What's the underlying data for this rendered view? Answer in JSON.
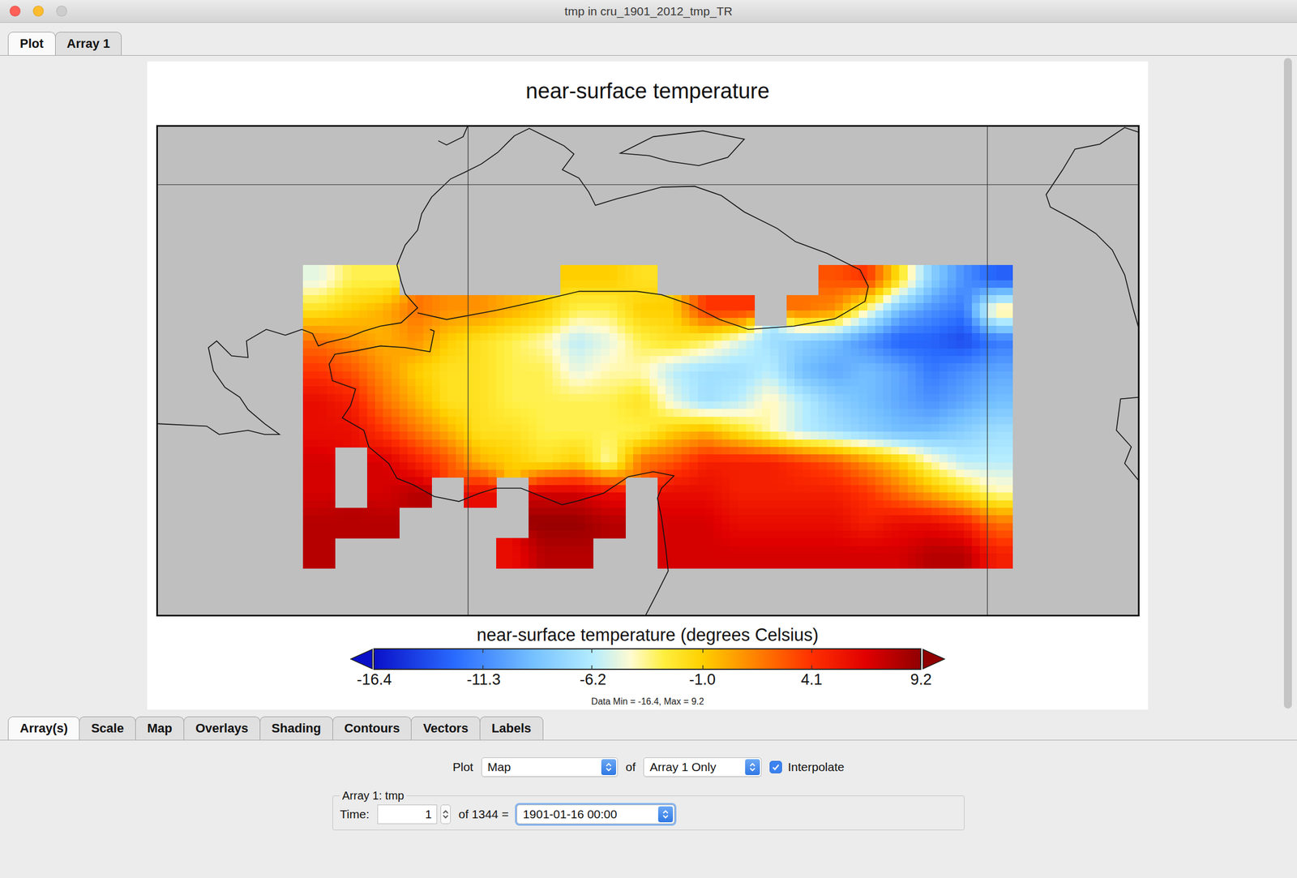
{
  "window": {
    "title": "tmp in cru_1901_2012_tmp_TR"
  },
  "top_tabs": [
    {
      "label": "Plot",
      "selected": true
    },
    {
      "label": "Array 1",
      "selected": false
    }
  ],
  "plot": {
    "title": "near-surface temperature",
    "map": {
      "grid": [
        [
          -5,
          -3,
          -3,
          null,
          null,
          null,
          null,
          null,
          -1,
          -1,
          -2,
          null,
          null,
          null,
          null,
          null,
          3,
          4,
          -2,
          -8,
          -11,
          -13
        ],
        [
          -2,
          -1,
          0,
          2,
          1,
          1,
          0,
          -1,
          -3,
          -3,
          -1,
          -1,
          4,
          4,
          null,
          2,
          1,
          -4,
          -9,
          -11,
          -12,
          -3
        ],
        [
          2,
          1,
          0,
          1,
          -1,
          -2,
          -3,
          -4,
          -6,
          -5,
          -3,
          -2,
          -3,
          -5,
          -7,
          -8,
          -9,
          -11,
          -13,
          -13,
          -14,
          -12
        ],
        [
          4,
          3,
          1,
          -1,
          -2,
          -2,
          -3,
          -3,
          -5,
          -4,
          -4,
          -6,
          -7,
          -7,
          -6,
          -9,
          -10,
          -9,
          -10,
          -12,
          -11,
          -10
        ],
        [
          6,
          5,
          2,
          0,
          -2,
          -2,
          -3,
          -3,
          -3,
          -3,
          -2,
          -5,
          -7,
          -6,
          -4,
          -6,
          -8,
          -9,
          -10,
          -11,
          -10,
          -9
        ],
        [
          6,
          6,
          4,
          2,
          0,
          -2,
          -2,
          -3,
          -3,
          -3,
          -3,
          -1,
          0,
          -2,
          -4,
          -6,
          -7,
          -8,
          -9,
          -9,
          -8,
          -7
        ],
        [
          7,
          null,
          7,
          5,
          3,
          0,
          -1,
          -2,
          -1,
          -4,
          2,
          3,
          5,
          5,
          5,
          4,
          3,
          1,
          -1,
          -4,
          -6,
          -6
        ],
        [
          7,
          null,
          7,
          8,
          null,
          6,
          null,
          7,
          7,
          6,
          null,
          6,
          6,
          5,
          5,
          5,
          5,
          4,
          2,
          0,
          -2,
          -4
        ],
        [
          8,
          8,
          8,
          null,
          null,
          null,
          null,
          9,
          9,
          8,
          null,
          7,
          7,
          6,
          6,
          6,
          6,
          5,
          6,
          6,
          5,
          2
        ],
        [
          8,
          null,
          null,
          null,
          null,
          null,
          6,
          8,
          8,
          null,
          null,
          7,
          7,
          7,
          7,
          7,
          7,
          7,
          7,
          8,
          8,
          5
        ]
      ]
    },
    "colorbar": {
      "label": "near-surface temperature (degrees Celsius)",
      "ticks": [
        "-16.4",
        "-11.3",
        "-6.2",
        "-1.0",
        "4.1",
        "9.2"
      ],
      "min": -16.4,
      "max": 9.2,
      "note": "Data Min = -16.4, Max = 9.2"
    }
  },
  "bottom_tabs": [
    {
      "label": "Array(s)",
      "selected": true
    },
    {
      "label": "Scale",
      "selected": false
    },
    {
      "label": "Map",
      "selected": false
    },
    {
      "label": "Overlays",
      "selected": false
    },
    {
      "label": "Shading",
      "selected": false
    },
    {
      "label": "Contours",
      "selected": false
    },
    {
      "label": "Vectors",
      "selected": false
    },
    {
      "label": "Labels",
      "selected": false
    }
  ],
  "controls": {
    "plot_label": "Plot",
    "plot_type": "Map",
    "of_label": "of",
    "arrays": "Array 1 Only",
    "interpolate": {
      "label": "Interpolate",
      "checked": true
    }
  },
  "array_group": {
    "legend": "Array 1: tmp",
    "time_label": "Time:",
    "time_value": "1",
    "of_text": "of 1344 =",
    "date": "1901-01-16 00:00"
  }
}
